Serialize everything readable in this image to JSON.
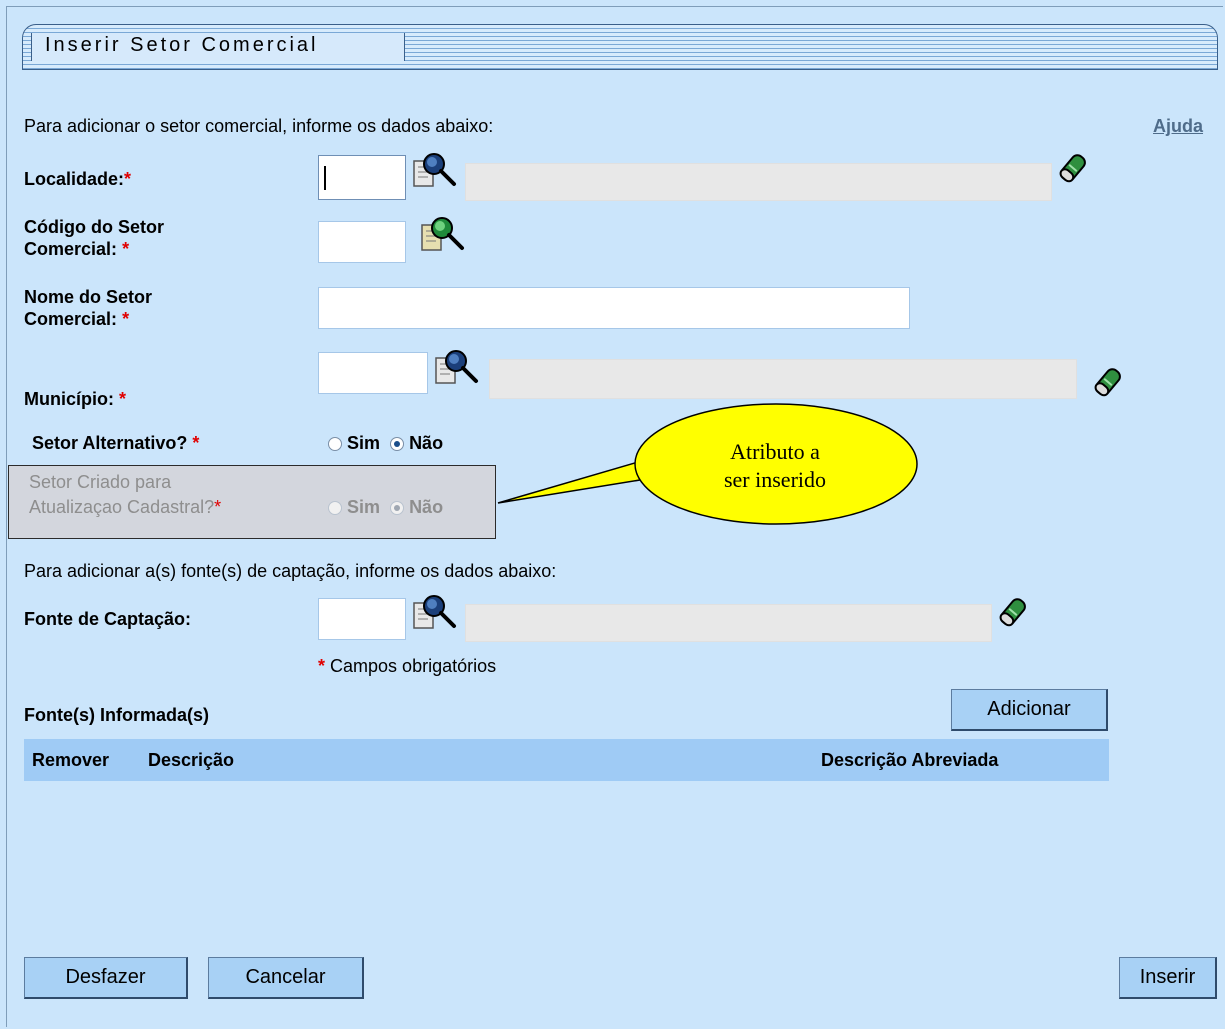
{
  "title": "Inserir Setor Comercial",
  "intro_text": "Para adicionar o setor comercial, informe os dados abaixo:",
  "help_link": "Ajuda",
  "fields": {
    "localidade": {
      "label": "Localidade:",
      "value": "",
      "description": ""
    },
    "codigo": {
      "label_line1": "Código do Setor",
      "label_line2": "Comercial:",
      "value": ""
    },
    "nome": {
      "label_line1": "Nome do Setor",
      "label_line2": "Comercial:",
      "value": ""
    },
    "municipio": {
      "label": "Município:",
      "value": "",
      "description": ""
    },
    "setor_alternativo": {
      "label": "Setor Alternativo?",
      "options": [
        "Sim",
        "Não"
      ],
      "selected": "Não"
    },
    "setor_criado": {
      "label_line1": "Setor Criado para",
      "label_line2": "Atualizaçao Cadastral?",
      "options": [
        "Sim",
        "Não"
      ],
      "selected": "Não"
    }
  },
  "required_marker": "*",
  "callout": {
    "line1": "Atributo a",
    "line2": "ser inserido"
  },
  "fonte_intro": "Para adicionar a(s) fonte(s) de captação, informe os dados abaixo:",
  "fonte": {
    "label": "Fonte de Captação:",
    "value": "",
    "description": ""
  },
  "required_note": "Campos obrigatórios",
  "fontes_informadas_label": "Fonte(s) Informada(s)",
  "add_button": "Adicionar",
  "table": {
    "columns": [
      "Remover",
      "Descrição",
      "Descrição Abreviada"
    ],
    "rows": []
  },
  "buttons": {
    "undo": "Desfazer",
    "cancel": "Cancelar",
    "insert": "Inserir"
  },
  "colors": {
    "background": "#cbe5fb",
    "required": "#e00000",
    "table_header": "#9fcbf5",
    "callout": "#ffff00"
  }
}
